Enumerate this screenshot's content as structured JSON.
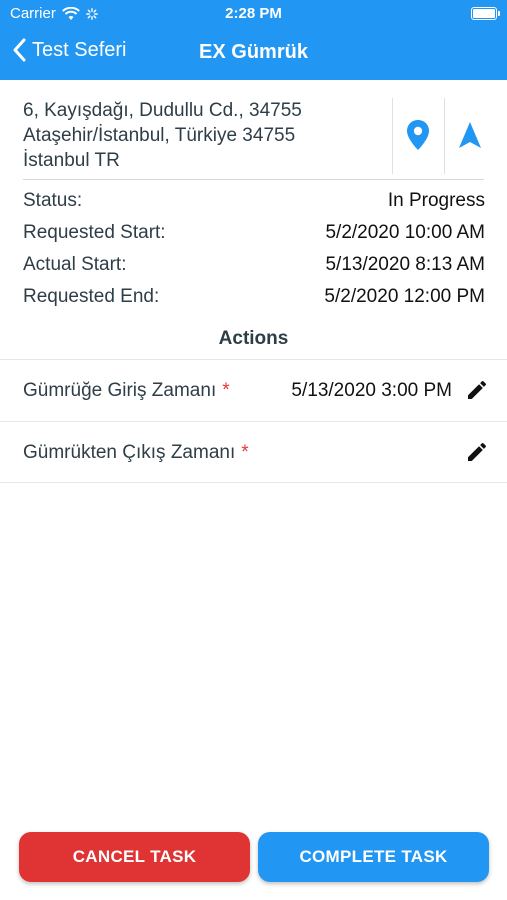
{
  "colors": {
    "primary": "#2196f3",
    "danger": "#e03333",
    "required": "#e53935"
  },
  "status_bar": {
    "carrier": "Carrier",
    "time": "2:28 PM"
  },
  "nav": {
    "back_label": "Test Seferi",
    "title": "EX Gümrük"
  },
  "address": {
    "line1": "6, Kayışdağı, Dudullu Cd., 34755",
    "line2": "Ataşehir/İstanbul, Türkiye 34755",
    "line3": "İstanbul TR",
    "location_icon": "map-pin-icon",
    "navigate_icon": "navigation-arrow-icon"
  },
  "info": [
    {
      "label": "Status:",
      "value": "In Progress"
    },
    {
      "label": "Requested Start:",
      "value": "5/2/2020 10:00 AM"
    },
    {
      "label": "Actual Start:",
      "value": "5/13/2020 8:13 AM"
    },
    {
      "label": "Requested End:",
      "value": "5/2/2020 12:00 PM"
    }
  ],
  "actions_title": "Actions",
  "actions": [
    {
      "label": "Gümrüğe Giriş Zamanı",
      "required_mark": "*",
      "value": "5/13/2020 3:00 PM",
      "icon": "pencil-icon"
    },
    {
      "label": "Gümrükten Çıkış Zamanı",
      "required_mark": "*",
      "value": "",
      "icon": "pencil-icon"
    }
  ],
  "buttons": {
    "cancel": "CANCEL TASK",
    "complete": "COMPLETE TASK"
  }
}
